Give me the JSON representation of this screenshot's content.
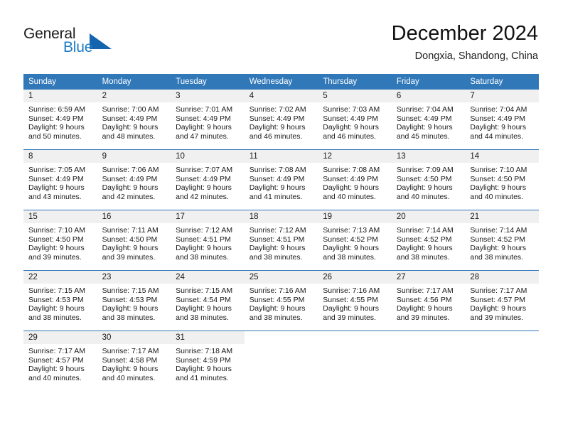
{
  "brand": {
    "name_part1": "General",
    "name_part2": "Blue",
    "triangle_icon": "blue-triangle-logo-mark"
  },
  "header": {
    "month_title": "December 2024",
    "location": "Dongxia, Shandong, China"
  },
  "colors": {
    "header_blue": "#3178b9",
    "logo_blue": "#1f7ac4",
    "triangle_blue": "#1565ae",
    "daynum_band": "#f0f0f0"
  },
  "weekday_headers": [
    "Sunday",
    "Monday",
    "Tuesday",
    "Wednesday",
    "Thursday",
    "Friday",
    "Saturday"
  ],
  "weeks": [
    [
      {
        "day": "1",
        "sunrise": "Sunrise: 6:59 AM",
        "sunset": "Sunset: 4:49 PM",
        "daylight1": "Daylight: 9 hours",
        "daylight2": "and 50 minutes."
      },
      {
        "day": "2",
        "sunrise": "Sunrise: 7:00 AM",
        "sunset": "Sunset: 4:49 PM",
        "daylight1": "Daylight: 9 hours",
        "daylight2": "and 48 minutes."
      },
      {
        "day": "3",
        "sunrise": "Sunrise: 7:01 AM",
        "sunset": "Sunset: 4:49 PM",
        "daylight1": "Daylight: 9 hours",
        "daylight2": "and 47 minutes."
      },
      {
        "day": "4",
        "sunrise": "Sunrise: 7:02 AM",
        "sunset": "Sunset: 4:49 PM",
        "daylight1": "Daylight: 9 hours",
        "daylight2": "and 46 minutes."
      },
      {
        "day": "5",
        "sunrise": "Sunrise: 7:03 AM",
        "sunset": "Sunset: 4:49 PM",
        "daylight1": "Daylight: 9 hours",
        "daylight2": "and 46 minutes."
      },
      {
        "day": "6",
        "sunrise": "Sunrise: 7:04 AM",
        "sunset": "Sunset: 4:49 PM",
        "daylight1": "Daylight: 9 hours",
        "daylight2": "and 45 minutes."
      },
      {
        "day": "7",
        "sunrise": "Sunrise: 7:04 AM",
        "sunset": "Sunset: 4:49 PM",
        "daylight1": "Daylight: 9 hours",
        "daylight2": "and 44 minutes."
      }
    ],
    [
      {
        "day": "8",
        "sunrise": "Sunrise: 7:05 AM",
        "sunset": "Sunset: 4:49 PM",
        "daylight1": "Daylight: 9 hours",
        "daylight2": "and 43 minutes."
      },
      {
        "day": "9",
        "sunrise": "Sunrise: 7:06 AM",
        "sunset": "Sunset: 4:49 PM",
        "daylight1": "Daylight: 9 hours",
        "daylight2": "and 42 minutes."
      },
      {
        "day": "10",
        "sunrise": "Sunrise: 7:07 AM",
        "sunset": "Sunset: 4:49 PM",
        "daylight1": "Daylight: 9 hours",
        "daylight2": "and 42 minutes."
      },
      {
        "day": "11",
        "sunrise": "Sunrise: 7:08 AM",
        "sunset": "Sunset: 4:49 PM",
        "daylight1": "Daylight: 9 hours",
        "daylight2": "and 41 minutes."
      },
      {
        "day": "12",
        "sunrise": "Sunrise: 7:08 AM",
        "sunset": "Sunset: 4:49 PM",
        "daylight1": "Daylight: 9 hours",
        "daylight2": "and 40 minutes."
      },
      {
        "day": "13",
        "sunrise": "Sunrise: 7:09 AM",
        "sunset": "Sunset: 4:50 PM",
        "daylight1": "Daylight: 9 hours",
        "daylight2": "and 40 minutes."
      },
      {
        "day": "14",
        "sunrise": "Sunrise: 7:10 AM",
        "sunset": "Sunset: 4:50 PM",
        "daylight1": "Daylight: 9 hours",
        "daylight2": "and 40 minutes."
      }
    ],
    [
      {
        "day": "15",
        "sunrise": "Sunrise: 7:10 AM",
        "sunset": "Sunset: 4:50 PM",
        "daylight1": "Daylight: 9 hours",
        "daylight2": "and 39 minutes."
      },
      {
        "day": "16",
        "sunrise": "Sunrise: 7:11 AM",
        "sunset": "Sunset: 4:50 PM",
        "daylight1": "Daylight: 9 hours",
        "daylight2": "and 39 minutes."
      },
      {
        "day": "17",
        "sunrise": "Sunrise: 7:12 AM",
        "sunset": "Sunset: 4:51 PM",
        "daylight1": "Daylight: 9 hours",
        "daylight2": "and 38 minutes."
      },
      {
        "day": "18",
        "sunrise": "Sunrise: 7:12 AM",
        "sunset": "Sunset: 4:51 PM",
        "daylight1": "Daylight: 9 hours",
        "daylight2": "and 38 minutes."
      },
      {
        "day": "19",
        "sunrise": "Sunrise: 7:13 AM",
        "sunset": "Sunset: 4:52 PM",
        "daylight1": "Daylight: 9 hours",
        "daylight2": "and 38 minutes."
      },
      {
        "day": "20",
        "sunrise": "Sunrise: 7:14 AM",
        "sunset": "Sunset: 4:52 PM",
        "daylight1": "Daylight: 9 hours",
        "daylight2": "and 38 minutes."
      },
      {
        "day": "21",
        "sunrise": "Sunrise: 7:14 AM",
        "sunset": "Sunset: 4:52 PM",
        "daylight1": "Daylight: 9 hours",
        "daylight2": "and 38 minutes."
      }
    ],
    [
      {
        "day": "22",
        "sunrise": "Sunrise: 7:15 AM",
        "sunset": "Sunset: 4:53 PM",
        "daylight1": "Daylight: 9 hours",
        "daylight2": "and 38 minutes."
      },
      {
        "day": "23",
        "sunrise": "Sunrise: 7:15 AM",
        "sunset": "Sunset: 4:53 PM",
        "daylight1": "Daylight: 9 hours",
        "daylight2": "and 38 minutes."
      },
      {
        "day": "24",
        "sunrise": "Sunrise: 7:15 AM",
        "sunset": "Sunset: 4:54 PM",
        "daylight1": "Daylight: 9 hours",
        "daylight2": "and 38 minutes."
      },
      {
        "day": "25",
        "sunrise": "Sunrise: 7:16 AM",
        "sunset": "Sunset: 4:55 PM",
        "daylight1": "Daylight: 9 hours",
        "daylight2": "and 38 minutes."
      },
      {
        "day": "26",
        "sunrise": "Sunrise: 7:16 AM",
        "sunset": "Sunset: 4:55 PM",
        "daylight1": "Daylight: 9 hours",
        "daylight2": "and 39 minutes."
      },
      {
        "day": "27",
        "sunrise": "Sunrise: 7:17 AM",
        "sunset": "Sunset: 4:56 PM",
        "daylight1": "Daylight: 9 hours",
        "daylight2": "and 39 minutes."
      },
      {
        "day": "28",
        "sunrise": "Sunrise: 7:17 AM",
        "sunset": "Sunset: 4:57 PM",
        "daylight1": "Daylight: 9 hours",
        "daylight2": "and 39 minutes."
      }
    ],
    [
      {
        "day": "29",
        "sunrise": "Sunrise: 7:17 AM",
        "sunset": "Sunset: 4:57 PM",
        "daylight1": "Daylight: 9 hours",
        "daylight2": "and 40 minutes."
      },
      {
        "day": "30",
        "sunrise": "Sunrise: 7:17 AM",
        "sunset": "Sunset: 4:58 PM",
        "daylight1": "Daylight: 9 hours",
        "daylight2": "and 40 minutes."
      },
      {
        "day": "31",
        "sunrise": "Sunrise: 7:18 AM",
        "sunset": "Sunset: 4:59 PM",
        "daylight1": "Daylight: 9 hours",
        "daylight2": "and 41 minutes."
      },
      {
        "day": "",
        "sunrise": "",
        "sunset": "",
        "daylight1": "",
        "daylight2": ""
      },
      {
        "day": "",
        "sunrise": "",
        "sunset": "",
        "daylight1": "",
        "daylight2": ""
      },
      {
        "day": "",
        "sunrise": "",
        "sunset": "",
        "daylight1": "",
        "daylight2": ""
      },
      {
        "day": "",
        "sunrise": "",
        "sunset": "",
        "daylight1": "",
        "daylight2": ""
      }
    ]
  ]
}
